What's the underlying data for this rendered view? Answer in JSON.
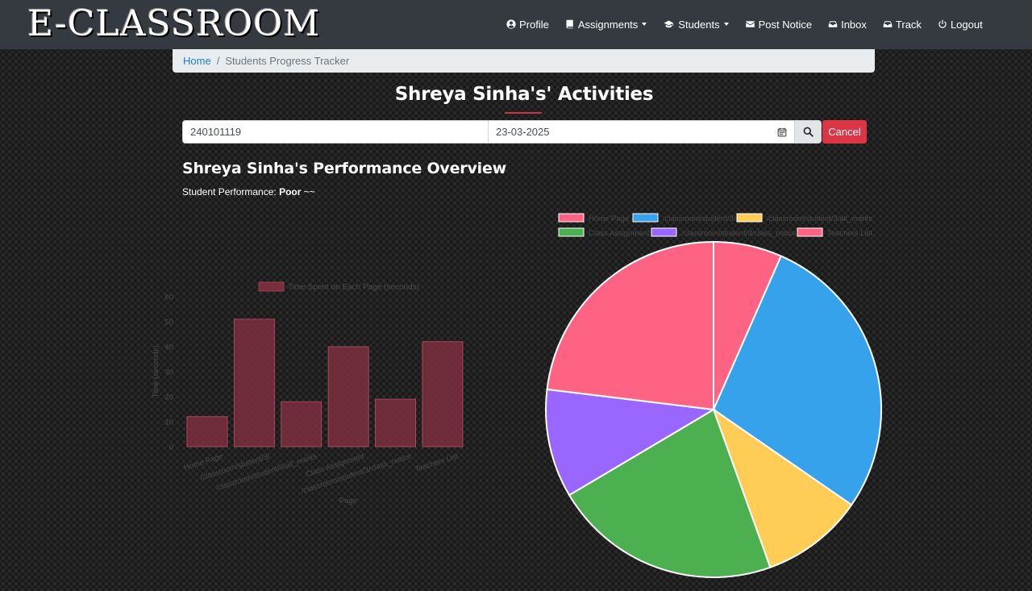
{
  "navbar": {
    "brand": "E-CLASSROOM",
    "links": [
      {
        "label": "Profile",
        "icon": "user-circle-icon",
        "dropdown": false
      },
      {
        "label": "Assignments",
        "icon": "book-icon",
        "dropdown": true
      },
      {
        "label": "Students",
        "icon": "graduation-cap-icon",
        "dropdown": true
      },
      {
        "label": "Post Notice",
        "icon": "envelope-icon",
        "dropdown": false
      },
      {
        "label": "Inbox",
        "icon": "inbox-icon",
        "dropdown": false
      },
      {
        "label": "Track",
        "icon": "inbox-icon",
        "dropdown": false
      },
      {
        "label": "Logout",
        "icon": "power-icon",
        "dropdown": false
      }
    ]
  },
  "breadcrumb": {
    "home": "Home",
    "current": "Students Progress Tracker"
  },
  "page_title": "Shreya Sinha's' Activities",
  "search": {
    "student_id": "240101119",
    "date": "23-03-2025",
    "cancel_label": "Cancel"
  },
  "overview": {
    "title": "Shreya Sinha's Performance Overview",
    "performance_label": "Student Performance:",
    "performance_value": "Poor",
    "performance_suffix": "~~"
  },
  "colors": {
    "navbar": "#343a40",
    "cancel": "#dc3545",
    "link": "#1e7bd6",
    "bar_fill": "#7a2d3d",
    "pie": [
      "#ff6384",
      "#36a2eb",
      "#ffcd56",
      "#4caf50",
      "#9966ff",
      "#ff6384"
    ]
  },
  "chart_data": [
    {
      "type": "bar",
      "legend": "Time Spent on Each Page (seconds)",
      "categories": [
        "Home Page",
        "/classroom/student/3/",
        "/classroom/student/3/all_marks",
        "Class Assignment",
        "/classroom/student/3/class_notice",
        "Teachers List"
      ],
      "values": [
        12,
        51,
        18,
        40,
        19,
        42
      ],
      "xlabel": "Page",
      "ylabel": "Time (seconds)",
      "ylim": [
        0,
        60
      ],
      "yticks": [
        0,
        10,
        20,
        30,
        40,
        50,
        60
      ]
    },
    {
      "type": "pie",
      "labels": [
        "Home Page",
        "/classroom/student/3/",
        "/classroom/student/3/all_marks",
        "Class Assignment",
        "/classroom/student/3/class_notice",
        "Teachers List"
      ],
      "values": [
        12,
        51,
        18,
        40,
        19,
        42
      ],
      "legend_placement": "top"
    }
  ]
}
